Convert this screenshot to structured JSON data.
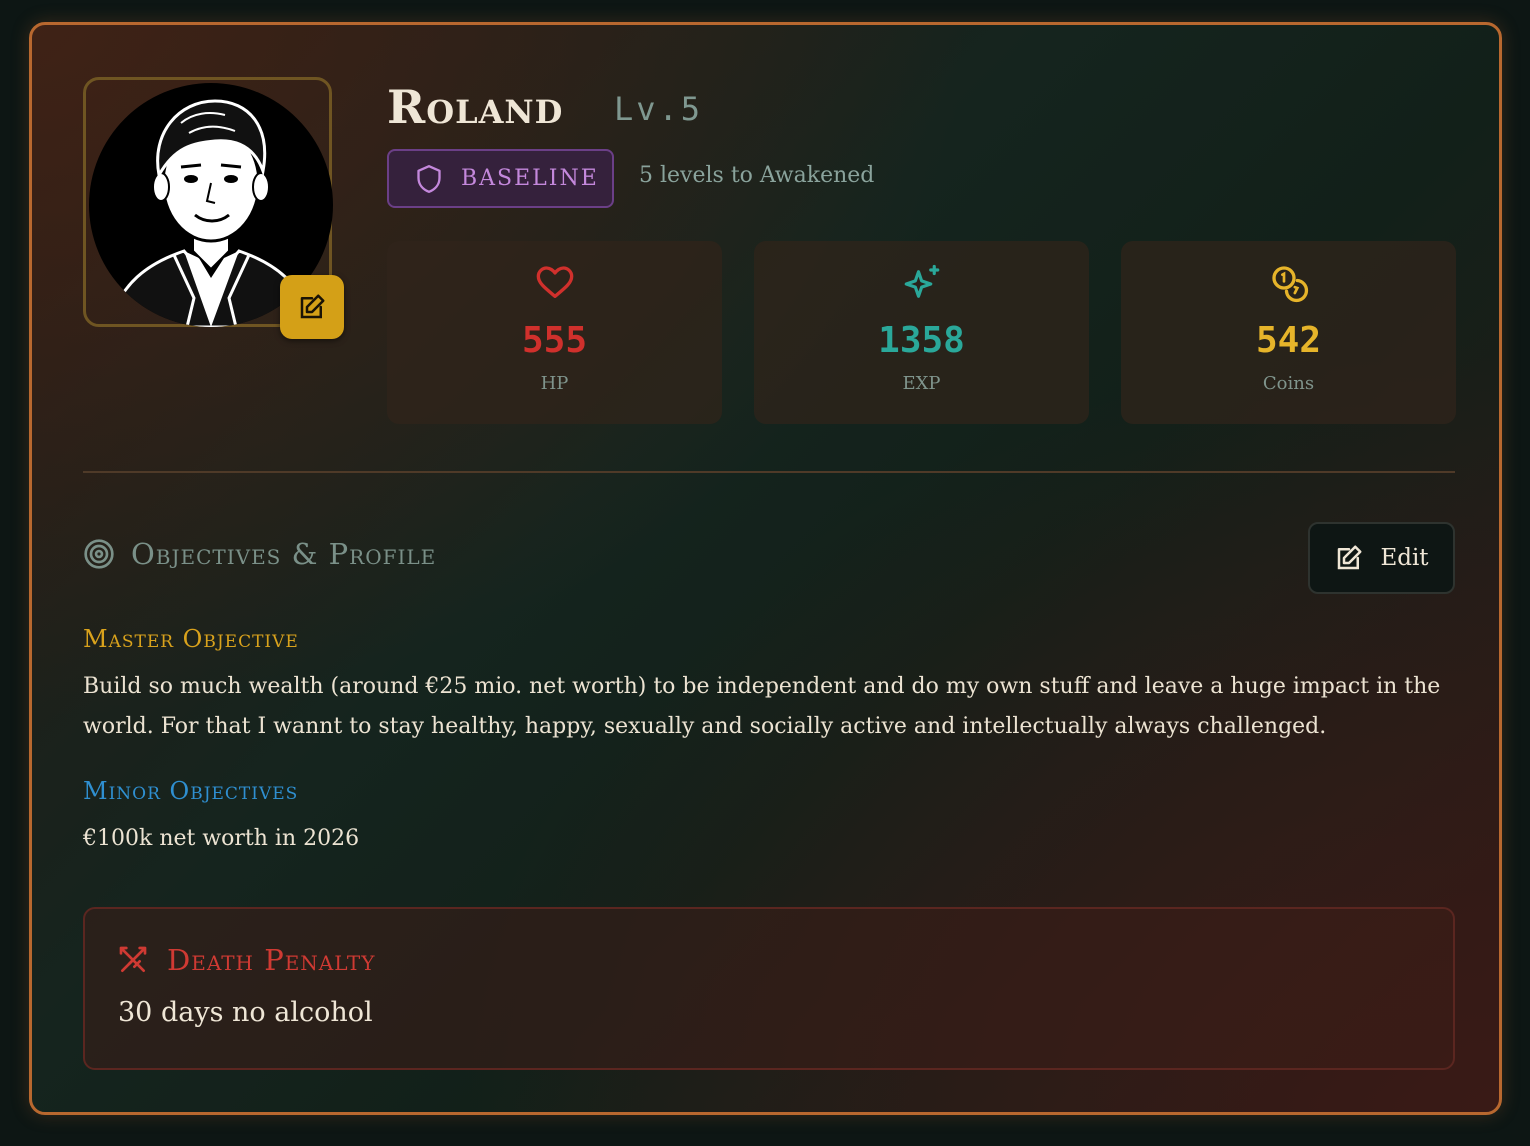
{
  "profile": {
    "name": "Roland",
    "level": "Lv.5",
    "rank": "BASELINE",
    "next_rank_hint": "5 levels to Awakened"
  },
  "stats": [
    {
      "value": "555",
      "label": "HP",
      "icon": "heart-icon",
      "color": "#d0302c"
    },
    {
      "value": "1358",
      "label": "EXP",
      "icon": "sparkle-icon",
      "color": "#2aa89a"
    },
    {
      "value": "542",
      "label": "Coins",
      "icon": "coins-icon",
      "color": "#e6b42a"
    }
  ],
  "objectives": {
    "section_title": "Objectives & Profile",
    "edit_label": "Edit",
    "master_title": "Master Objective",
    "master_text": "Build so much wealth (around €25 mio. net worth) to be independent and do my own stuff and leave a huge impact in the world. For that I wannt to stay healthy, happy, sexually and socially active and intellectually always challenged.",
    "minor_title": "Minor Objectives",
    "minor_text": "€100k net worth in 2026"
  },
  "death_penalty": {
    "title": "Death Penalty",
    "text": "30 days no alcohol"
  },
  "colors": {
    "accent_border": "#b8682f",
    "gold": "#d4a017",
    "master_heading": "#d9a21c",
    "minor_heading": "#2f8fd0",
    "danger": "#cf3a33"
  }
}
